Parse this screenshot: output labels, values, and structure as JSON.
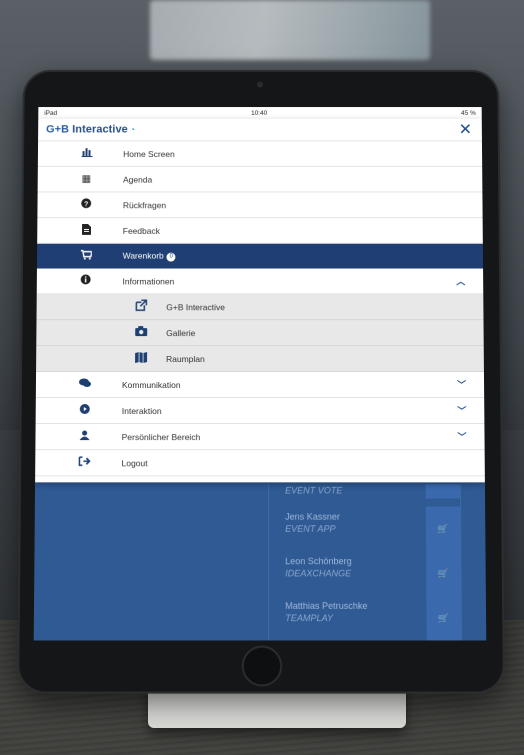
{
  "status_bar": {
    "carrier": "iPad",
    "time": "10:40",
    "battery": "45 %"
  },
  "header": {
    "logo_gb": "G+B",
    "logo_text": "Interactive",
    "close_label": "✕"
  },
  "menu": {
    "items": [
      {
        "label": "Home Screen",
        "icon": "bar-chart-icon"
      },
      {
        "label": "Agenda",
        "icon": "calendar-icon"
      },
      {
        "label": "Rückfragen",
        "icon": "question-icon"
      },
      {
        "label": "Feedback",
        "icon": "document-icon"
      },
      {
        "label": "Warenkorb",
        "icon": "cart-icon",
        "badge": "0",
        "active": true
      },
      {
        "label": "Informationen",
        "icon": "info-icon",
        "expanded": true
      }
    ],
    "sub_items": [
      {
        "label": "G+B Interactive",
        "icon": "external-link-icon"
      },
      {
        "label": "Gallerie",
        "icon": "camera-icon"
      },
      {
        "label": "Raumplan",
        "icon": "map-icon"
      }
    ],
    "more_items": [
      {
        "label": "Kommunikation",
        "icon": "chat-icon"
      },
      {
        "label": "Interaktion",
        "icon": "play-icon"
      },
      {
        "label": "Persönlicher Bereich",
        "icon": "user-icon"
      },
      {
        "label": "Logout",
        "icon": "logout-icon"
      }
    ]
  },
  "background_list": [
    {
      "name": "",
      "subtitle": "EVENT VOTE"
    },
    {
      "name": "Jens Kassner",
      "subtitle": "EVENT APP"
    },
    {
      "name": "Leon Schönberg",
      "subtitle": "IDEAXCHANGE"
    },
    {
      "name": "Matthias Petruschke",
      "subtitle": "TEAMPLAY"
    }
  ],
  "colors": {
    "active_row": "#1f3f74",
    "brand_blue": "#234e86",
    "app_bg": "#2f5a94"
  }
}
